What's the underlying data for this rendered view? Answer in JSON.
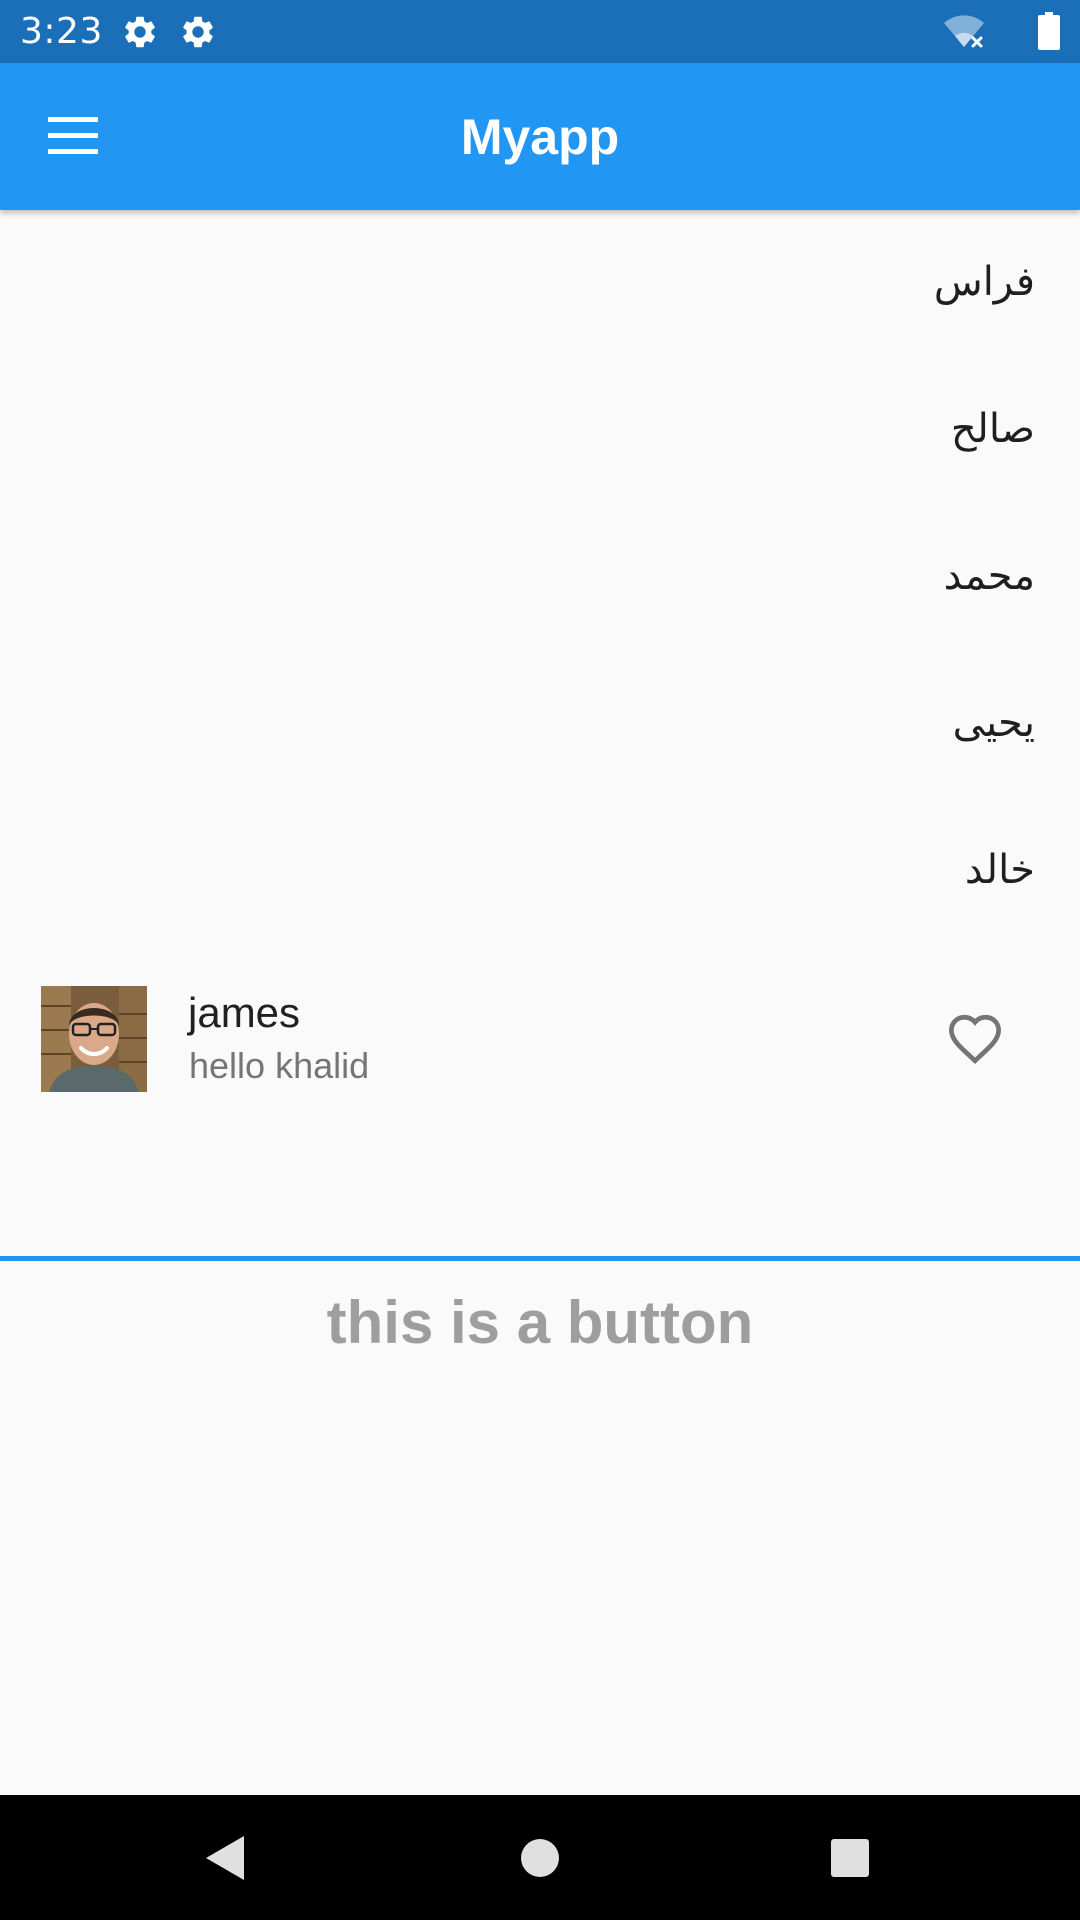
{
  "status_bar": {
    "time": "3:23",
    "icons": [
      "gear-icon",
      "gear-icon",
      "wifi-off-icon",
      "battery-icon"
    ],
    "background": "#1b6fb8"
  },
  "app_bar": {
    "title": "Myapp",
    "menu_icon": "menu-icon",
    "background": "#2196f3"
  },
  "names": [
    "فراس",
    "صالح",
    "محمد",
    "يحيى",
    "خالد"
  ],
  "card": {
    "title": "james",
    "subtitle": "hello khalid",
    "avatar": "avatar-photo",
    "trailing_icon": "heart-outline-icon"
  },
  "bottom_button": {
    "label": "this is a button",
    "accent": "#2196f3"
  },
  "nav_bar": {
    "buttons": [
      "back-icon",
      "home-icon",
      "recents-icon"
    ]
  }
}
